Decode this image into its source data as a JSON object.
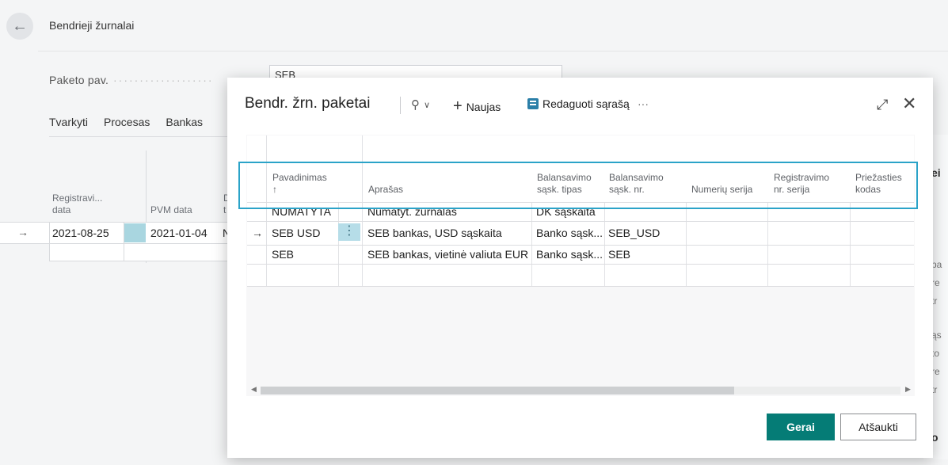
{
  "background": {
    "title": "Bendrieji žurnalai",
    "field_label": "Paketo pav.",
    "field_value": "SEB",
    "actions": [
      "Tvarkyti",
      "Procesas",
      "Bankas"
    ],
    "columns": [
      {
        "label": "Registravi...",
        "label2": "data"
      },
      {
        "label": "PVM data",
        "label2": ""
      },
      {
        "label": "D",
        "label2": "t"
      }
    ],
    "row": {
      "registration_date": "2021-08-25",
      "vat_date": "2021-01-04",
      "code": "N"
    },
    "right_text": [
      "ei",
      "pa",
      "re",
      "tr",
      "ąs",
      "to",
      "re",
      "tr",
      "o"
    ]
  },
  "modal": {
    "title": "Bendr. žrn. paketai",
    "toolbar": {
      "new_label": "Naujas",
      "edit_list_label": "Redaguoti sąrašą",
      "more_label": "···"
    },
    "columns": [
      {
        "line1": "Pavadinimas",
        "line2": "↑"
      },
      {
        "line1": "",
        "line2": "Aprašas"
      },
      {
        "line1": "Balansavimo",
        "line2": "sąsk. tipas"
      },
      {
        "line1": "Balansavimo",
        "line2": "sąsk. nr."
      },
      {
        "line1": "",
        "line2": "Numerių serija"
      },
      {
        "line1": "Registravimo",
        "line2": "nr. serija"
      },
      {
        "line1": "Priežasties",
        "line2": "kodas"
      }
    ],
    "rows": [
      {
        "name": "NUMATYTA",
        "description": "Numatyt. žurnalas",
        "bal_type": "DK sąskaita",
        "bal_no": ""
      },
      {
        "name": "SEB USD",
        "description": "SEB bankas, USD sąskaita",
        "bal_type": "Banko sąsk...",
        "bal_no": "SEB_USD"
      },
      {
        "name": "SEB",
        "description": "SEB bankas, vietinė valiuta EUR",
        "bal_type": "Banko sąsk...",
        "bal_no": "SEB"
      }
    ],
    "ok_label": "Gerai",
    "cancel_label": "Atšaukti"
  },
  "colors": {
    "accent": "#057c76",
    "selection": "#2ba3c8",
    "row_highlight": "#b6dde8"
  }
}
